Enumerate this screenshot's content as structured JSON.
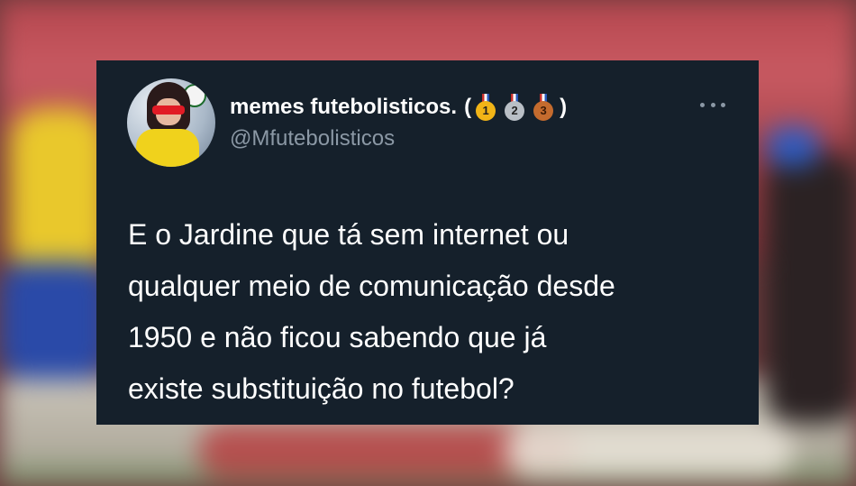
{
  "tweet": {
    "display_name": "memes futebolisticos.",
    "name_open": "(",
    "name_close": ")",
    "medals": [
      "1",
      "2",
      "3"
    ],
    "handle": "@Mfutebolisticos",
    "text_lines": [
      "E o Jardine que tá sem internet ou",
      "qualquer meio de comunicação desde",
      "1950 e não ficou sabendo que já",
      "existe substituição no futebol?"
    ]
  },
  "colors": {
    "card_background": "#15202b",
    "text_primary": "#ffffff",
    "text_secondary": "#8b98a5"
  },
  "icons": {
    "more": "more-horizontal-icon",
    "medals": [
      "gold-medal-icon",
      "silver-medal-icon",
      "bronze-medal-icon"
    ]
  }
}
